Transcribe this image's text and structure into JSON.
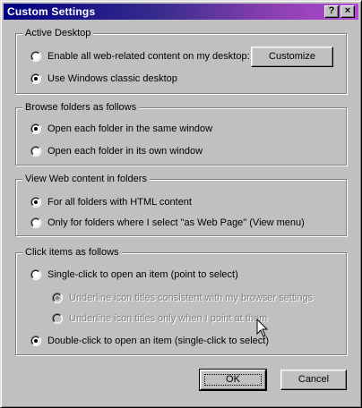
{
  "window": {
    "title": "Custom Settings",
    "help_glyph": "?",
    "close_glyph": "×"
  },
  "groups": {
    "active_desktop": {
      "legend": "Active Desktop",
      "options": [
        {
          "label": "Enable all web-related content on my desktop:",
          "checked": false
        },
        {
          "label": "Use Windows classic desktop",
          "checked": true
        }
      ],
      "customize_label": "Customize"
    },
    "browse_folders": {
      "legend": "Browse folders as follows",
      "options": [
        {
          "label": "Open each folder in the same window",
          "checked": true
        },
        {
          "label": "Open each folder in its own window",
          "checked": false
        }
      ]
    },
    "view_web": {
      "legend": "View Web content in folders",
      "options": [
        {
          "label": "For all folders with HTML content",
          "checked": true
        },
        {
          "label": "Only for folders where I select \"as Web Page\" (View menu)",
          "checked": false
        }
      ]
    },
    "click_items": {
      "legend": "Click items as follows",
      "options": [
        {
          "label": "Single-click to open an item (point to select)",
          "checked": false
        },
        {
          "label": "Underline icon titles consistent with my browser settings",
          "checked": true,
          "disabled": true
        },
        {
          "label": "Underline icon titles only when I point at them",
          "checked": false,
          "disabled": true
        },
        {
          "label": "Double-click to open an item (single-click to select)",
          "checked": true
        }
      ]
    }
  },
  "buttons": {
    "ok": "OK",
    "cancel": "Cancel"
  },
  "colors": {
    "face": "#c0c0c0",
    "titlebar_start": "#000080",
    "titlebar_end": "#b04ad0",
    "disabled_text": "#808080"
  },
  "icons": {
    "cursor": "arrow-cursor-icon"
  }
}
